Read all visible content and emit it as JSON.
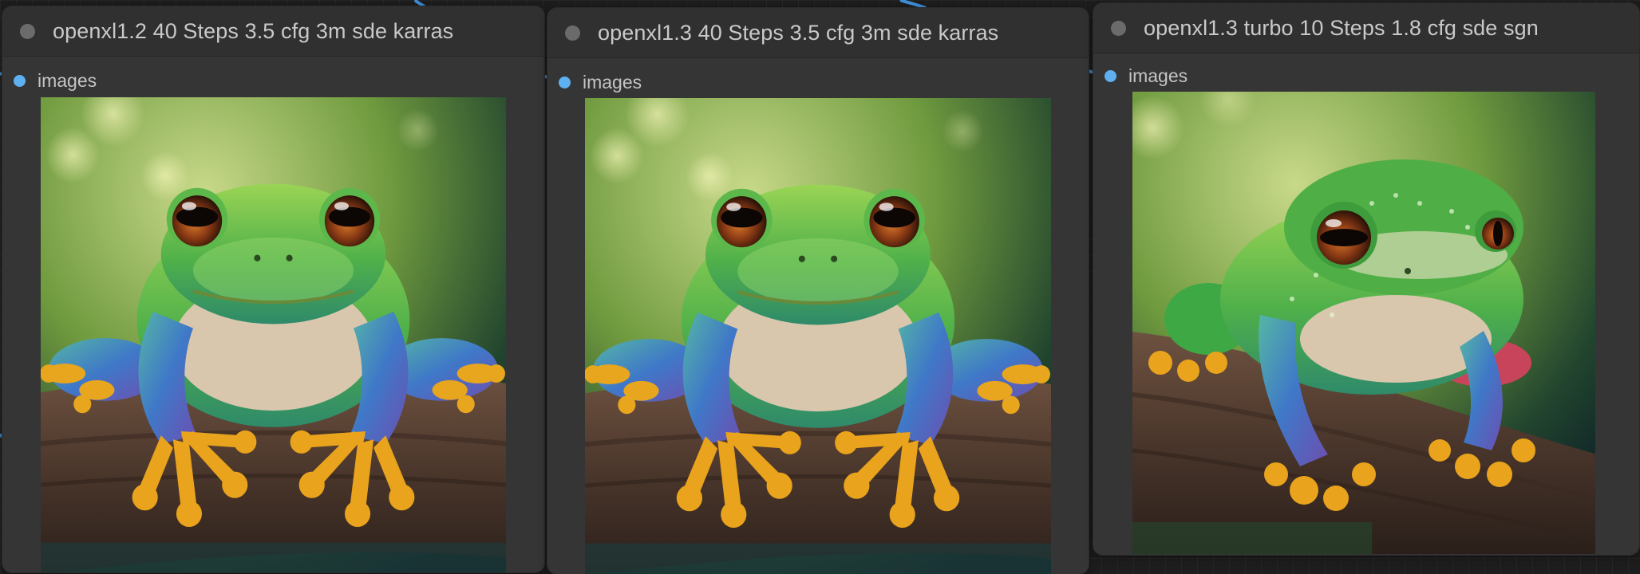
{
  "nodes": [
    {
      "title": "openxl1.2 40 Steps 3.5 cfg 3m sde karras",
      "output_label": "images"
    },
    {
      "title": "openxl1.3 40 Steps 3.5 cfg 3m sde karras",
      "output_label": "images"
    },
    {
      "title": "openxl1.3 turbo 10 Steps 1.8 cfg sde sgn",
      "output_label": "images"
    }
  ],
  "colors": {
    "canvas": "#1d1d1d",
    "node_body": "#353535",
    "node_title": "#303030",
    "slot": "#5eb0f0",
    "wire": "#3f8fd8"
  },
  "preview_subject": "frog-on-branch-photo"
}
